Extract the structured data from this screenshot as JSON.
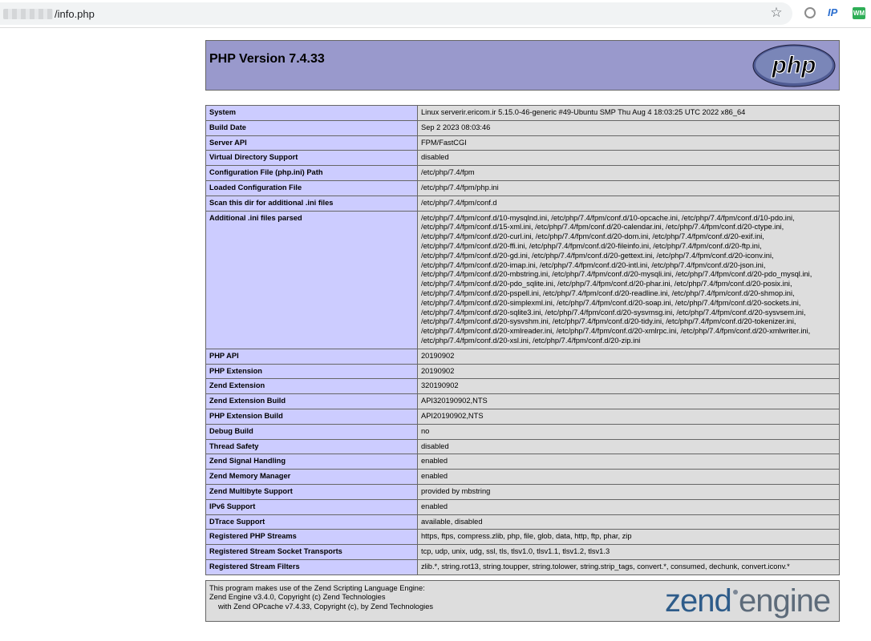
{
  "browser": {
    "url_path": "/info.php",
    "star_glyph": "☆",
    "ext_ip_label": "IP",
    "ext_wm_label": "WM"
  },
  "php": {
    "title": "PHP Version 7.4.33",
    "logo_text": "php"
  },
  "info_rows": [
    {
      "key": "System",
      "value": "Linux serverir.ericom.ir 5.15.0-46-generic #49-Ubuntu SMP Thu Aug 4 18:03:25 UTC 2022 x86_64"
    },
    {
      "key": "Build Date",
      "value": "Sep 2 2023 08:03:46"
    },
    {
      "key": "Server API",
      "value": "FPM/FastCGI"
    },
    {
      "key": "Virtual Directory Support",
      "value": "disabled"
    },
    {
      "key": "Configuration File (php.ini) Path",
      "value": "/etc/php/7.4/fpm"
    },
    {
      "key": "Loaded Configuration File",
      "value": "/etc/php/7.4/fpm/php.ini"
    },
    {
      "key": "Scan this dir for additional .ini files",
      "value": "/etc/php/7.4/fpm/conf.d"
    },
    {
      "key": "Additional .ini files parsed",
      "value": "/etc/php/7.4/fpm/conf.d/10-mysqlnd.ini, /etc/php/7.4/fpm/conf.d/10-opcache.ini, /etc/php/7.4/fpm/conf.d/10-pdo.ini, /etc/php/7.4/fpm/conf.d/15-xml.ini, /etc/php/7.4/fpm/conf.d/20-calendar.ini, /etc/php/7.4/fpm/conf.d/20-ctype.ini, /etc/php/7.4/fpm/conf.d/20-curl.ini, /etc/php/7.4/fpm/conf.d/20-dom.ini, /etc/php/7.4/fpm/conf.d/20-exif.ini, /etc/php/7.4/fpm/conf.d/20-ffi.ini, /etc/php/7.4/fpm/conf.d/20-fileinfo.ini, /etc/php/7.4/fpm/conf.d/20-ftp.ini, /etc/php/7.4/fpm/conf.d/20-gd.ini, /etc/php/7.4/fpm/conf.d/20-gettext.ini, /etc/php/7.4/fpm/conf.d/20-iconv.ini, /etc/php/7.4/fpm/conf.d/20-imap.ini, /etc/php/7.4/fpm/conf.d/20-intl.ini, /etc/php/7.4/fpm/conf.d/20-json.ini, /etc/php/7.4/fpm/conf.d/20-mbstring.ini, /etc/php/7.4/fpm/conf.d/20-mysqli.ini, /etc/php/7.4/fpm/conf.d/20-pdo_mysql.ini, /etc/php/7.4/fpm/conf.d/20-pdo_sqlite.ini, /etc/php/7.4/fpm/conf.d/20-phar.ini, /etc/php/7.4/fpm/conf.d/20-posix.ini, /etc/php/7.4/fpm/conf.d/20-pspell.ini, /etc/php/7.4/fpm/conf.d/20-readline.ini, /etc/php/7.4/fpm/conf.d/20-shmop.ini, /etc/php/7.4/fpm/conf.d/20-simplexml.ini, /etc/php/7.4/fpm/conf.d/20-soap.ini, /etc/php/7.4/fpm/conf.d/20-sockets.ini, /etc/php/7.4/fpm/conf.d/20-sqlite3.ini, /etc/php/7.4/fpm/conf.d/20-sysvmsg.ini, /etc/php/7.4/fpm/conf.d/20-sysvsem.ini, /etc/php/7.4/fpm/conf.d/20-sysvshm.ini, /etc/php/7.4/fpm/conf.d/20-tidy.ini, /etc/php/7.4/fpm/conf.d/20-tokenizer.ini, /etc/php/7.4/fpm/conf.d/20-xmlreader.ini, /etc/php/7.4/fpm/conf.d/20-xmlrpc.ini, /etc/php/7.4/fpm/conf.d/20-xmlwriter.ini, /etc/php/7.4/fpm/conf.d/20-xsl.ini, /etc/php/7.4/fpm/conf.d/20-zip.ini"
    },
    {
      "key": "PHP API",
      "value": "20190902"
    },
    {
      "key": "PHP Extension",
      "value": "20190902"
    },
    {
      "key": "Zend Extension",
      "value": "320190902"
    },
    {
      "key": "Zend Extension Build",
      "value": "API320190902,NTS"
    },
    {
      "key": "PHP Extension Build",
      "value": "API20190902,NTS"
    },
    {
      "key": "Debug Build",
      "value": "no"
    },
    {
      "key": "Thread Safety",
      "value": "disabled"
    },
    {
      "key": "Zend Signal Handling",
      "value": "enabled"
    },
    {
      "key": "Zend Memory Manager",
      "value": "enabled"
    },
    {
      "key": "Zend Multibyte Support",
      "value": "provided by mbstring"
    },
    {
      "key": "IPv6 Support",
      "value": "enabled"
    },
    {
      "key": "DTrace Support",
      "value": "available, disabled"
    },
    {
      "key": "Registered PHP Streams",
      "value": "https, ftps, compress.zlib, php, file, glob, data, http, ftp, phar, zip"
    },
    {
      "key": "Registered Stream Socket Transports",
      "value": "tcp, udp, unix, udg, ssl, tls, tlsv1.0, tlsv1.1, tlsv1.2, tlsv1.3"
    },
    {
      "key": "Registered Stream Filters",
      "value": "zlib.*, string.rot13, string.toupper, string.tolower, string.strip_tags, convert.*, consumed, dechunk, convert.iconv.*"
    }
  ],
  "credits": {
    "line1": "This program makes use of the Zend Scripting Language Engine:",
    "line2": "Zend Engine v3.4.0, Copyright (c) Zend Technologies",
    "line3": "with Zend OPcache v7.4.33, Copyright (c), by Zend Technologies",
    "logo_word1": "zend",
    "logo_word2": "engine"
  },
  "colors": {
    "header_bg": "#9999cc",
    "key_bg": "#ccccff",
    "value_bg": "#dddddd",
    "border": "#666666"
  }
}
